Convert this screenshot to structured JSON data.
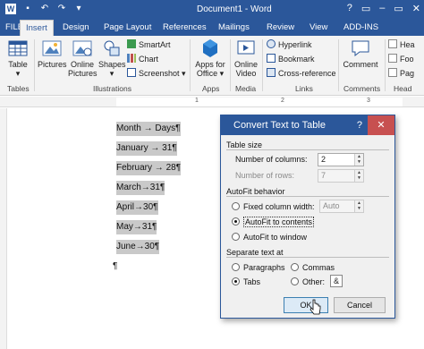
{
  "window": {
    "title": "Document1 - Word",
    "controls": [
      "?",
      "▭",
      "–",
      "▭",
      "✕"
    ]
  },
  "ribbon_tabs": [
    "FILE",
    "Insert",
    "Design",
    "Page Layout",
    "References",
    "Mailings",
    "Review",
    "View",
    "ADD-INS"
  ],
  "ribbon": {
    "tables": {
      "table_label": "Table",
      "group": "Tables"
    },
    "illustrations": {
      "pictures": "Pictures",
      "online_pictures_1": "Online",
      "online_pictures_2": "Pictures",
      "shapes": "Shapes",
      "smartart": "SmartArt",
      "chart": "Chart",
      "screenshot": "Screenshot",
      "group": "Illustrations"
    },
    "apps": {
      "apps_1": "Apps for",
      "apps_2": "Office",
      "group": "Apps"
    },
    "media": {
      "video_1": "Online",
      "video_2": "Video",
      "group": "Media"
    },
    "links": {
      "hyperlink": "Hyperlink",
      "bookmark": "Bookmark",
      "cross_reference": "Cross-reference",
      "group": "Links"
    },
    "comments": {
      "comment": "Comment",
      "group": "Comments"
    },
    "header": {
      "item1": "Hea",
      "item2": "Foo",
      "item3": "Pag",
      "group": "Head"
    }
  },
  "ruler": {
    "numbers": [
      "1",
      "2",
      "3"
    ]
  },
  "document": {
    "lines": [
      {
        "text": "Month → Days¶",
        "selected": true
      },
      {
        "text": "January → 31¶",
        "selected": true
      },
      {
        "text": "February → 28¶",
        "selected": true
      },
      {
        "text": "March→31¶",
        "selected": true
      },
      {
        "text": "April→30¶",
        "selected": true
      },
      {
        "text": "May→31¶",
        "selected": true
      },
      {
        "text": "June→30¶",
        "selected": true
      },
      {
        "text": "¶",
        "selected": false
      }
    ]
  },
  "dialog": {
    "title": "Convert Text to Table",
    "help": "?",
    "close": "✕",
    "table_size": "Table size",
    "num_columns_label": "Number of columns:",
    "num_columns_value": "2",
    "num_rows_label": "Number of rows:",
    "num_rows_value": "7",
    "autofit": "AutoFit behavior",
    "fixed_width": "Fixed column width:",
    "fixed_width_value": "Auto",
    "autofit_contents": "AutoFit to contents",
    "autofit_window": "AutoFit to window",
    "separate": "Separate text at",
    "paragraphs": "Paragraphs",
    "commas": "Commas",
    "tabs": "Tabs",
    "other": "Other:",
    "other_value": "&",
    "ok": "OK",
    "cancel": "Cancel"
  },
  "colors": {
    "accent": "#2b579a",
    "close_red": "#c75050",
    "selection": "#c9c9c9"
  }
}
